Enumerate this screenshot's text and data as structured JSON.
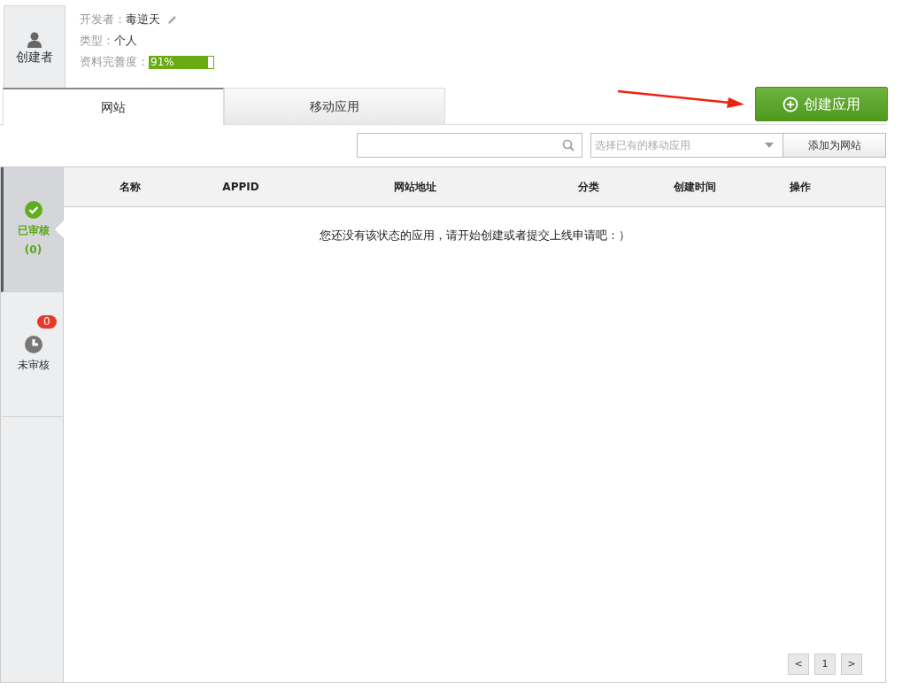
{
  "profile": {
    "avatar_label": "创建者",
    "fields": [
      {
        "label": "开发者：",
        "value": "毒逆天",
        "editable": true
      },
      {
        "label": "类型：",
        "value": "个人",
        "editable": false
      }
    ],
    "completeness": {
      "label": "资料完善度：",
      "reading": "91%",
      "level": 0.91
    }
  },
  "tabs": [
    {
      "label": "网站",
      "selected": true
    },
    {
      "label": "移动应用",
      "selected": false
    }
  ],
  "create_button": "创建应用",
  "mobile_select": {
    "placeholder": "选择已有的移动应用"
  },
  "add_button": "添加为网站",
  "sidebar": [
    {
      "kind": "approved",
      "label": "已审核",
      "count": "(0)",
      "selected": true
    },
    {
      "kind": "pending",
      "label": "未审核",
      "badge": "0",
      "selected": false
    }
  ],
  "table": {
    "columns": [
      "名称",
      "APPID",
      "网站地址",
      "分类",
      "创建时间",
      "操作"
    ],
    "empty_message": "您还没有该状态的应用，请开始创建或者提交上线申请吧：）"
  },
  "pagination": [
    "<",
    "1",
    ">"
  ]
}
